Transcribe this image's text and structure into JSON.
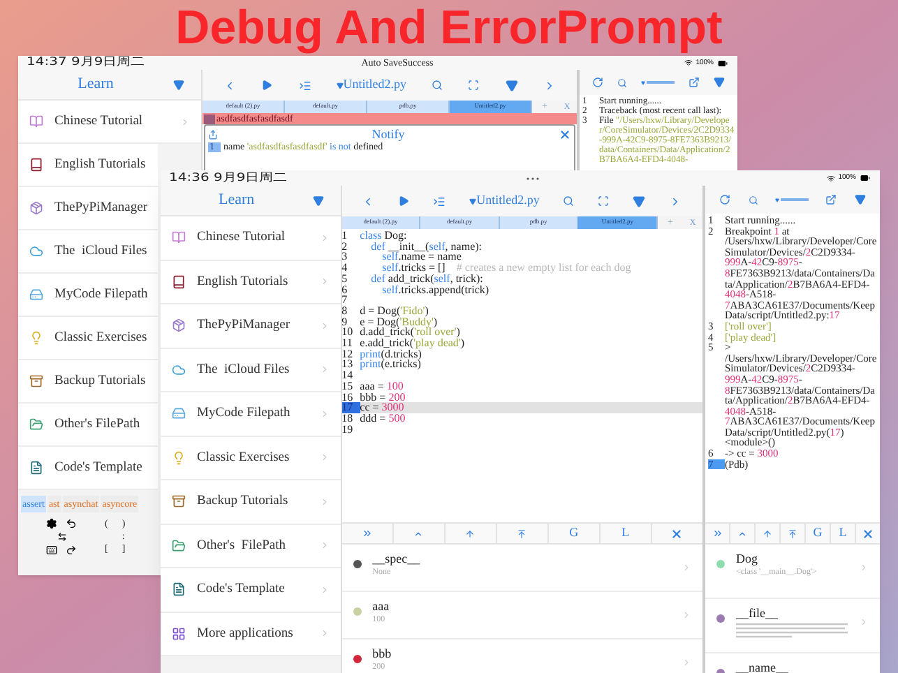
{
  "title": "Debug And ErrorPrompt",
  "back_screen": {
    "status_bar": {
      "time": "14:37  9月9日周二",
      "notice": "Auto SaveSuccess",
      "battery": "100%"
    },
    "sidebar": {
      "header": "Learn",
      "items": [
        "Chinese Tutorial",
        "English Tutorials",
        "ThePyPiManager",
        "The  iCloud Files",
        "MyCode Filepath",
        "Classic Exercises",
        "Backup Tutorials",
        "Other's FilePath",
        "Code's Template"
      ]
    },
    "keyword_bar": [
      {
        "label": "assert",
        "selected": true
      },
      {
        "label": "ast",
        "selected": false
      },
      {
        "label": "asynchat",
        "selected": false
      },
      {
        "label": "asyncore",
        "selected": false
      }
    ],
    "keypad": [
      "(",
      ")",
      ":",
      "[",
      "]"
    ],
    "editor": {
      "file": "Untitled2.py",
      "tabs": [
        {
          "label": "default (2).py",
          "selected": false
        },
        {
          "label": "default.py",
          "selected": false
        },
        {
          "label": "pdb.py",
          "selected": false
        },
        {
          "label": "Untitled2.py",
          "selected": true
        }
      ],
      "add_tab": "+",
      "close_tab": "X",
      "error_line": "asdfasdfasfasdfasdf",
      "notify": {
        "title": "Notify",
        "line": "1",
        "message": [
          {
            "text": "name ",
            "kind": "plain"
          },
          {
            "text": "'asdfasdfasfasdfasdf'",
            "kind": "string"
          },
          {
            "text": " is not",
            "kind": "keyword"
          },
          {
            "text": " defined",
            "kind": "plain"
          }
        ]
      }
    },
    "console": {
      "lines": [
        {
          "no": "1",
          "current": false,
          "parts": [
            {
              "text": "Start running......",
              "kind": "plain"
            }
          ]
        },
        {
          "no": "2",
          "current": false,
          "parts": [
            {
              "text": "Traceback (most recent call last):",
              "kind": "plain"
            }
          ]
        },
        {
          "no": "3",
          "current": false,
          "parts": [
            {
              "text": "File ",
              "kind": "plain"
            },
            {
              "text": "\"/Users/hxw/Library/Developer/CoreSimulator/Devices/2C2D9334-999A-42C9-8975-8FE7363B9213/data/Containers/Data/Application/2B7BA6A4-EFD4-4048-",
              "kind": "string"
            }
          ]
        }
      ]
    }
  },
  "front_screen": {
    "status_bar": {
      "time": "14:36  9月9日周二",
      "battery": "100%"
    },
    "sidebar": {
      "header": "Learn",
      "items": [
        "Chinese Tutorial",
        "English Tutorials",
        "ThePyPiManager",
        "The  iCloud Files",
        "MyCode Filepath",
        "Classic Exercises",
        "Backup Tutorials",
        "Other's  FilePath",
        "Code's Template",
        "More applications"
      ]
    },
    "editor": {
      "file": "Untitled2.py",
      "tabs": [
        {
          "label": "default (2).py",
          "selected": false
        },
        {
          "label": "default.py",
          "selected": false
        },
        {
          "label": "pdb.py",
          "selected": false
        },
        {
          "label": "Untitled2.py",
          "selected": true
        }
      ],
      "add_tab": "+",
      "close_tab": "X",
      "code": [
        {
          "no": "1",
          "current": false,
          "parts": [
            {
              "text": "class",
              "kind": "keyword"
            },
            {
              "text": " Dog:",
              "kind": "plain"
            }
          ]
        },
        {
          "no": "2",
          "current": false,
          "parts": [
            {
              "text": "    def",
              "kind": "keyword"
            },
            {
              "text": " __init__(",
              "kind": "plain"
            },
            {
              "text": "self",
              "kind": "keyword"
            },
            {
              "text": ", name):",
              "kind": "plain"
            }
          ]
        },
        {
          "no": "3",
          "current": false,
          "parts": [
            {
              "text": "        self",
              "kind": "keyword"
            },
            {
              "text": ".name = name",
              "kind": "plain"
            }
          ]
        },
        {
          "no": "4",
          "current": false,
          "parts": [
            {
              "text": "        self",
              "kind": "keyword"
            },
            {
              "text": ".tricks = []    ",
              "kind": "plain"
            },
            {
              "text": "# creates a new empty list for each dog",
              "kind": "comment"
            }
          ]
        },
        {
          "no": "5",
          "current": false,
          "parts": [
            {
              "text": "    def",
              "kind": "keyword"
            },
            {
              "text": " add_trick(",
              "kind": "plain"
            },
            {
              "text": "self",
              "kind": "keyword"
            },
            {
              "text": ", trick):",
              "kind": "plain"
            }
          ]
        },
        {
          "no": "6",
          "current": false,
          "parts": [
            {
              "text": "        self",
              "kind": "keyword"
            },
            {
              "text": ".tricks.append(trick)",
              "kind": "plain"
            }
          ]
        },
        {
          "no": "7",
          "current": false
        },
        {
          "no": "8",
          "current": false,
          "parts": [
            {
              "text": "d = Dog(",
              "kind": "plain"
            },
            {
              "text": "'Fido'",
              "kind": "string"
            },
            {
              "text": ")",
              "kind": "plain"
            }
          ]
        },
        {
          "no": "9",
          "current": false,
          "parts": [
            {
              "text": "e = Dog(",
              "kind": "plain"
            },
            {
              "text": "'Buddy'",
              "kind": "string"
            },
            {
              "text": ")",
              "kind": "plain"
            }
          ]
        },
        {
          "no": "10",
          "current": false,
          "parts": [
            {
              "text": "d.add_trick(",
              "kind": "plain"
            },
            {
              "text": "'roll over'",
              "kind": "string"
            },
            {
              "text": ")",
              "kind": "plain"
            }
          ]
        },
        {
          "no": "11",
          "current": false,
          "parts": [
            {
              "text": "e.add_trick(",
              "kind": "plain"
            },
            {
              "text": "'play dead'",
              "kind": "string"
            },
            {
              "text": ")",
              "kind": "plain"
            }
          ]
        },
        {
          "no": "12",
          "current": false,
          "parts": [
            {
              "text": "print",
              "kind": "keyword"
            },
            {
              "text": "(d.tricks)",
              "kind": "plain"
            }
          ]
        },
        {
          "no": "13",
          "current": false,
          "parts": [
            {
              "text": "print",
              "kind": "keyword"
            },
            {
              "text": "(e.tricks)",
              "kind": "plain"
            }
          ]
        },
        {
          "no": "14",
          "current": false
        },
        {
          "no": "15",
          "current": false,
          "parts": [
            {
              "text": "aaa = ",
              "kind": "plain"
            },
            {
              "text": "100",
              "kind": "number"
            }
          ]
        },
        {
          "no": "16",
          "current": false,
          "parts": [
            {
              "text": "bbb = ",
              "kind": "plain"
            },
            {
              "text": "200",
              "kind": "number"
            }
          ]
        },
        {
          "no": "17",
          "current": true,
          "parts": [
            {
              "text": "cc = ",
              "kind": "plain"
            },
            {
              "text": "3000",
              "kind": "number"
            }
          ]
        },
        {
          "no": "18",
          "current": false,
          "parts": [
            {
              "text": "ddd = ",
              "kind": "plain"
            },
            {
              "text": "500",
              "kind": "number"
            }
          ]
        },
        {
          "no": "19",
          "current": false
        }
      ],
      "debug_bar": {
        "goto": "G",
        "locals": "L"
      },
      "variables": [
        {
          "name": "__spec__",
          "value": "None",
          "color": "#555555"
        },
        {
          "name": "aaa",
          "value": "100",
          "color": "#c9d1a3"
        },
        {
          "name": "bbb",
          "value": "200",
          "color": "#d0283a"
        }
      ]
    },
    "console": {
      "lines": [
        {
          "no": "1",
          "current": false,
          "parts": [
            {
              "text": "Start running......",
              "kind": "plain"
            }
          ]
        },
        {
          "no": "2",
          "current": false,
          "parts": [
            {
              "text": "Breakpoint ",
              "kind": "plain"
            },
            {
              "text": "1",
              "kind": "number"
            },
            {
              "text": " at /Users/hxw/Library/Developer/CoreSimulator/Devices/",
              "kind": "plain"
            },
            {
              "text": "2",
              "kind": "number"
            },
            {
              "text": "C2D9334-",
              "kind": "plain"
            },
            {
              "text": "999",
              "kind": "number"
            },
            {
              "text": "A-",
              "kind": "plain"
            },
            {
              "text": "42",
              "kind": "number"
            },
            {
              "text": "C9-",
              "kind": "plain"
            },
            {
              "text": "8975",
              "kind": "number"
            },
            {
              "text": "-",
              "kind": "plain"
            },
            {
              "text": "8",
              "kind": "number"
            },
            {
              "text": "FE7363B9213/data/Containers/Data/Application/",
              "kind": "plain"
            },
            {
              "text": "2",
              "kind": "number"
            },
            {
              "text": "B7BA6A4-EFD4-",
              "kind": "plain"
            },
            {
              "text": "4048",
              "kind": "number"
            },
            {
              "text": "-A518-",
              "kind": "plain"
            },
            {
              "text": "7",
              "kind": "number"
            },
            {
              "text": "ABA3CA61E37/Documents/KeepData/script/Untitled2.py:",
              "kind": "plain"
            },
            {
              "text": "17",
              "kind": "number"
            }
          ]
        },
        {
          "no": "3",
          "current": false,
          "parts": [
            {
              "text": "['roll over']",
              "kind": "string"
            }
          ]
        },
        {
          "no": "4",
          "current": false,
          "parts": [
            {
              "text": "['play dead']",
              "kind": "string"
            }
          ]
        },
        {
          "no": "5",
          "current": false,
          "parts": [
            {
              "text": "> /Users/hxw/Library/Developer/CoreSimulator/Devices/",
              "kind": "plain"
            },
            {
              "text": "2",
              "kind": "number"
            },
            {
              "text": "C2D9334-",
              "kind": "plain"
            },
            {
              "text": "999",
              "kind": "number"
            },
            {
              "text": "A-",
              "kind": "plain"
            },
            {
              "text": "42",
              "kind": "number"
            },
            {
              "text": "C9-",
              "kind": "plain"
            },
            {
              "text": "8975",
              "kind": "number"
            },
            {
              "text": "-",
              "kind": "plain"
            },
            {
              "text": "8",
              "kind": "number"
            },
            {
              "text": "FE7363B9213/data/Containers/Data/Application/",
              "kind": "plain"
            },
            {
              "text": "2",
              "kind": "number"
            },
            {
              "text": "B7BA6A4-EFD4-",
              "kind": "plain"
            },
            {
              "text": "4048",
              "kind": "number"
            },
            {
              "text": "-A518-",
              "kind": "plain"
            },
            {
              "text": "7",
              "kind": "number"
            },
            {
              "text": "ABA3CA61E37/Documents/KeepData/script/Untitled2.py(",
              "kind": "plain"
            },
            {
              "text": "17",
              "kind": "number"
            },
            {
              "text": ")<module>()",
              "kind": "plain"
            }
          ]
        },
        {
          "no": "6",
          "current": false,
          "parts": [
            {
              "text": "-> cc = ",
              "kind": "plain"
            },
            {
              "text": "3000",
              "kind": "number"
            }
          ]
        },
        {
          "no": "7",
          "current": true,
          "parts": [
            {
              "text": "(Pdb)",
              "kind": "plain"
            }
          ]
        }
      ],
      "debug_bar": {
        "goto": "G",
        "locals": "L"
      },
      "variables": [
        {
          "name": "Dog",
          "value": "<class '__main__.Dog'>",
          "color": "#8fdcb0"
        },
        {
          "name": "__file__",
          "color": "#9b7bb0"
        },
        {
          "name": "__name__",
          "color": "#9b7bb0"
        }
      ]
    }
  }
}
